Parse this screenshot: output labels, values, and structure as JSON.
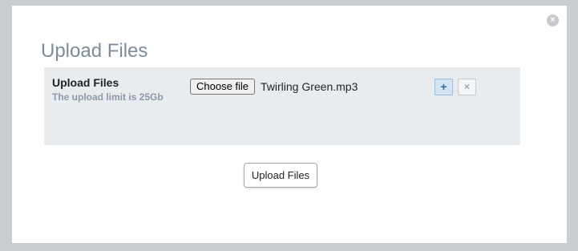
{
  "modal": {
    "close_icon": "×",
    "title": "Upload Files"
  },
  "upload_row": {
    "label": "Upload Files",
    "hint": "The upload limit is 25Gb",
    "choose_file_label": "Choose file",
    "file_name": "Twirling Green.mp3",
    "add_icon": "+",
    "remove_icon": "×"
  },
  "actions": {
    "submit_label": "Upload Files"
  }
}
